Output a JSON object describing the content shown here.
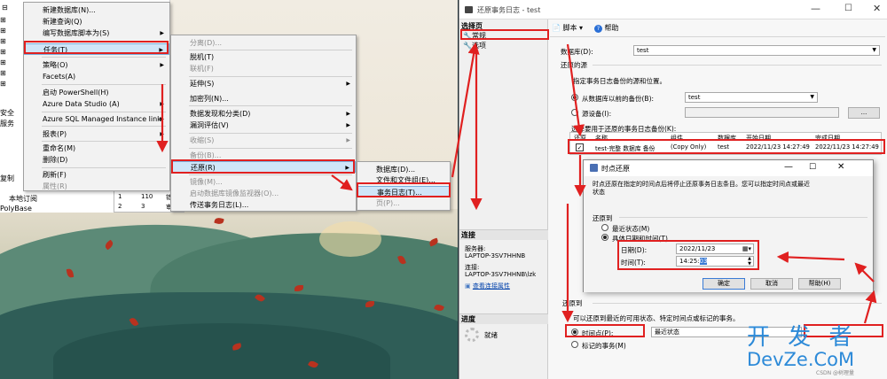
{
  "ssms": {
    "tree_rows": [
      "安全",
      "服务",
      "复制",
      "本地订阅",
      "PolyBase"
    ],
    "mini_table": {
      "rows": [
        [
          "1",
          "110",
          "错"
        ],
        [
          "2",
          "3",
          "审"
        ]
      ]
    }
  },
  "context_menu_1": {
    "items": [
      {
        "label": "新建数据库(N)...",
        "disabled": false
      },
      {
        "label": "新建查询(Q)",
        "disabled": false
      },
      {
        "label": "编写数据库脚本为(S)",
        "disabled": false,
        "submenu": true
      },
      {
        "label": "任务(T)",
        "disabled": false,
        "submenu": true,
        "highlight": true
      },
      {
        "label": "策略(O)",
        "disabled": false,
        "submenu": true
      },
      {
        "label": "Facets(A)",
        "disabled": false
      },
      {
        "label": "启动 PowerShell(H)",
        "disabled": false
      },
      {
        "label": "Azure Data Studio (A)",
        "disabled": false,
        "submenu": true
      },
      {
        "label": "Azure SQL Managed Instance link",
        "disabled": false,
        "submenu": true
      },
      {
        "label": "报表(P)",
        "disabled": false,
        "submenu": true
      },
      {
        "label": "重命名(M)",
        "disabled": false
      },
      {
        "label": "删除(D)",
        "disabled": false
      },
      {
        "label": "刷新(F)",
        "disabled": false
      },
      {
        "label": "属性(R)",
        "disabled": true
      }
    ]
  },
  "context_menu_2": {
    "items": [
      {
        "label": "分离(D)...",
        "disabled": true
      },
      {
        "label": "脱机(T)",
        "disabled": false
      },
      {
        "label": "联机(F)",
        "disabled": true
      },
      {
        "label": "延伸(S)",
        "disabled": false,
        "submenu": true
      },
      {
        "label": "加密列(N)...",
        "disabled": false
      },
      {
        "label": "数据发现和分类(D)",
        "disabled": false,
        "submenu": true
      },
      {
        "label": "漏洞评估(V)",
        "disabled": false,
        "submenu": true
      },
      {
        "label": "收缩(S)",
        "disabled": true,
        "submenu": true
      },
      {
        "label": "备份(B)...",
        "disabled": true
      },
      {
        "label": "还原(R)",
        "disabled": false,
        "submenu": true,
        "highlight": true
      },
      {
        "label": "镜像(M)...",
        "disabled": true
      },
      {
        "label": "启动数据库镜像监视器(O)...",
        "disabled": true
      },
      {
        "label": "传送事务日志(L)...",
        "disabled": false
      }
    ]
  },
  "context_menu_3": {
    "items": [
      {
        "label": "数据库(D)...",
        "disabled": false
      },
      {
        "label": "文件和文件组(E)...",
        "disabled": false
      },
      {
        "label": "事务日志(T)...",
        "disabled": false,
        "highlight": true
      },
      {
        "label": "页(P)...",
        "disabled": true
      }
    ]
  },
  "dialog": {
    "title": "还原事务日志 - test",
    "select_page_header": "选择页",
    "pages": [
      "常规",
      "选项"
    ],
    "toolbar_script": "脚本",
    "toolbar_help": "帮助",
    "database_label": "数据库(D):",
    "database_value": "test",
    "restore_source_header": "还原的源",
    "restore_source_desc": "指定事务日志备份的源和位置。",
    "from_prev_backup": "从数据库以前的备份(B):",
    "from_prev_backup_value": "test",
    "from_device": "源设备(I):",
    "browse_btn": "...",
    "select_backups_label": "选择要用于还原的事务日志备份(K):",
    "table_headers": [
      "还原",
      "名称",
      "组件",
      "数据库",
      "开始日期",
      "完成日期"
    ],
    "table_row": [
      "test-完整 数据库 备份",
      "(Copy Only)",
      "test",
      "2022/11/23 14:27:49",
      "2022/11/23 14:27:49"
    ],
    "connection_header": "连接",
    "server_label": "服务器:",
    "server_value": "LAPTOP-3SV7HHNB",
    "conn_label": "连接:",
    "conn_value": "LAPTOP-3SV7HHNB\\lzk",
    "view_props": "查看连接属性",
    "progress_header": "进度",
    "progress_status": "就绪",
    "restore_to_header": "还原到",
    "restore_to_desc": "可以还原到最近的可用状态、特定时间点或标记的事务。",
    "point_in_time": "时间点(P):",
    "point_in_time_value": "最近状态",
    "marked_tx": "标记的事务(M)"
  },
  "pit_dialog": {
    "title": "时点还原",
    "desc": "时点还原在指定的时间点后将停止还原事务日志条目。您可以指定时间点或最近状态",
    "restore_to": "还原到",
    "latest": "最近状态(M)",
    "specific": "具体日期和时间(T)",
    "date_label": "日期(D):",
    "date_value": "2022/11/23",
    "time_label": "时间(T):",
    "time_value": "14:25:",
    "time_sel": "03",
    "ok": "确定",
    "cancel": "取消",
    "help": "帮助(H)"
  },
  "watermark": {
    "line1": "开 发 者",
    "line2": "DevZe.CoM",
    "line3": "CSDN @树理量"
  },
  "colors": {
    "accent_red": "#e02020",
    "highlight": "#cfe5f8",
    "link": "#0645ad"
  }
}
